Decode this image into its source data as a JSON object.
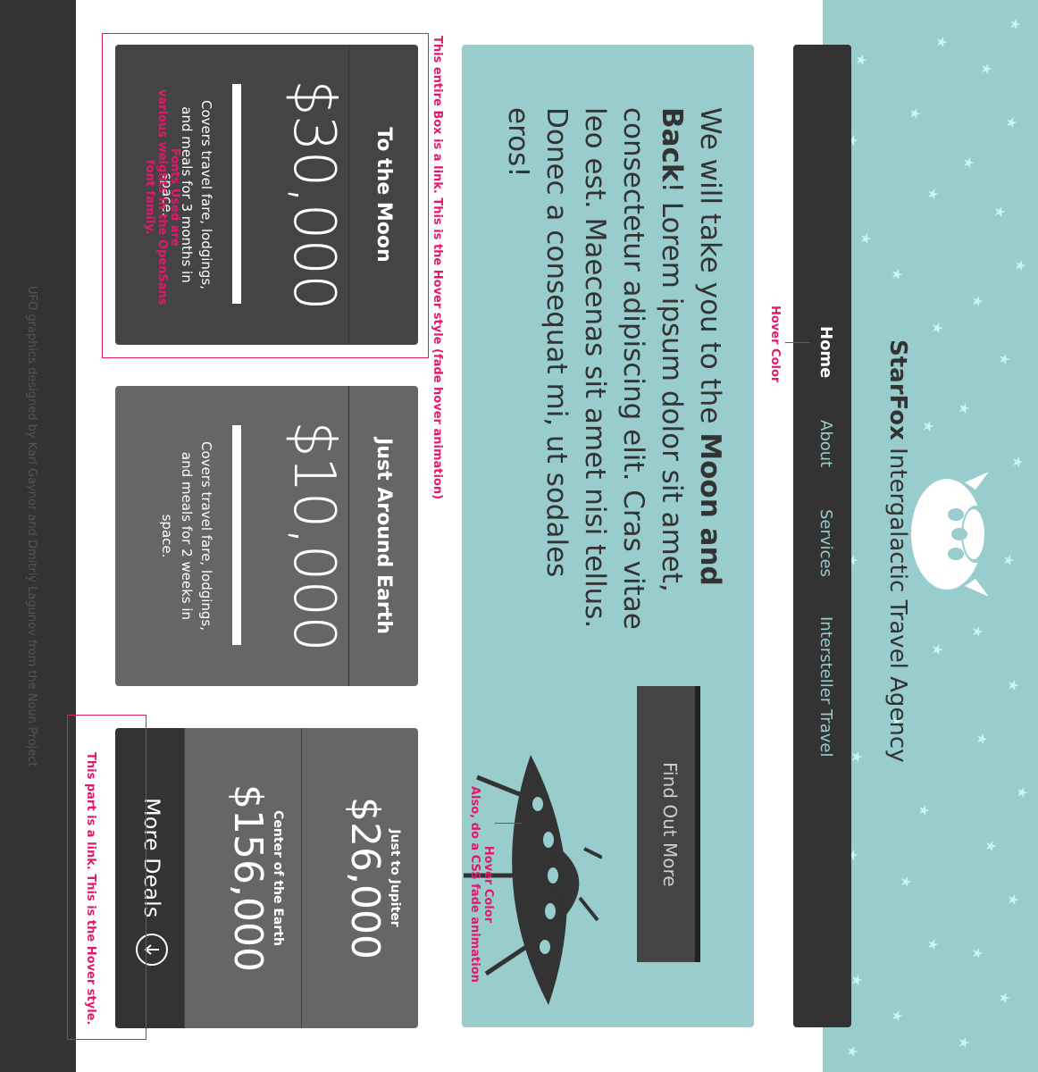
{
  "site": {
    "brand_bold": "StarFox",
    "brand_light": "Intergalactic Travel Agency"
  },
  "nav": {
    "items": [
      {
        "label": "Home",
        "active": true
      },
      {
        "label": "About",
        "active": false
      },
      {
        "label": "Services",
        "active": false
      },
      {
        "label": "Intersteller Travel",
        "active": false
      }
    ]
  },
  "hero": {
    "text_pre": "We will take you to the ",
    "text_bold": "Moon and Back",
    "text_post": "! Lorem ipsum dolor sit amet, consectetur adipiscing elit. Cras vitae leo est. Maecenas sit amet nisi tellus. Donec a consequat mi, ut sodales eros!",
    "button_label": "Find Out More"
  },
  "deals": [
    {
      "title": "To the Moon",
      "price": "$30,000",
      "description": "Covers travel fare, lodgings, and meals for 3 months in space."
    },
    {
      "title": "Just Around Earth",
      "price": "$10,000",
      "description": "Covers travel fare, lodgings, and meals for 2 weeks in space."
    }
  ],
  "mini_deals": [
    {
      "title": "Just to Jupiter",
      "price": "$26,000"
    },
    {
      "title": "Center of the Earth",
      "price": "$156,000"
    }
  ],
  "more_deals_label": "More Deals",
  "footer": {
    "credit": "UFO graphics designed by Karl Gaynor and Dmitriy Lagunov from the Noun Project"
  },
  "annotations": {
    "fonts": "Fonts Used are various weights in the OpenSans font family.",
    "fonts_line1": "Fonts Used are",
    "fonts_line2": "various weights in the OpenSans",
    "fonts_line3": "font family.",
    "nav_hover": "Hover Color",
    "button_hover_line1": "Hover Color",
    "button_hover_line2": "Also, do a CSS fade animation",
    "box_link": "This entire Box is a link. This is the Hover style (fade hover animation)",
    "more_link": "This part is a link. This is the Hover style."
  },
  "colors": {
    "teal": "#99cccd",
    "dark": "#333333",
    "card": "#444444",
    "card_alt": "#666666",
    "annotation": "#e2196a",
    "star": "#c8f5ee"
  }
}
